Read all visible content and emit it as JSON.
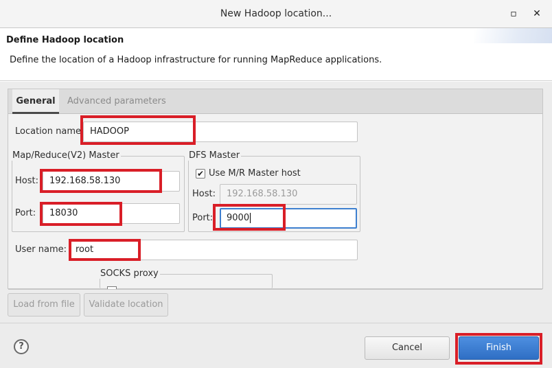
{
  "window": {
    "title": "New Hadoop location...",
    "minimize_glyph": "▫",
    "close_glyph": "✕"
  },
  "header": {
    "title": "Define Hadoop location",
    "description": "Define the location of a Hadoop infrastructure for running MapReduce applications."
  },
  "tabs": [
    {
      "label": "General",
      "selected": true
    },
    {
      "label": "Advanced parameters",
      "selected": false
    }
  ],
  "general": {
    "location_name_label": "Location name:",
    "location_name_value": "HADOOP",
    "mr_master": {
      "legend": "Map/Reduce(V2) Master",
      "host_label": "Host:",
      "host_value": "192.168.58.130",
      "port_label": "Port:",
      "port_value": "18030"
    },
    "dfs_master": {
      "legend": "DFS Master",
      "use_mr_host_label": "Use M/R Master host",
      "use_mr_host_checked": true,
      "host_label": "Host:",
      "host_value": "192.168.58.130",
      "port_label": "Port:",
      "port_value": "9000"
    },
    "user_name_label": "User name:",
    "user_name_value": "root",
    "socks_proxy": {
      "legend": "SOCKS proxy"
    }
  },
  "buttons": {
    "load_from_file": "Load from file",
    "validate_location": "Validate location",
    "cancel": "Cancel",
    "finish": "Finish",
    "help": "?"
  },
  "colors": {
    "accent": "#3d7fcf",
    "finish_button": "#2f6fc4",
    "highlight_annotation": "#d91e27"
  },
  "icons": {
    "help": "help-icon",
    "close": "close-icon",
    "minimize": "minimize-icon",
    "checkbox": "checkmark-icon"
  }
}
